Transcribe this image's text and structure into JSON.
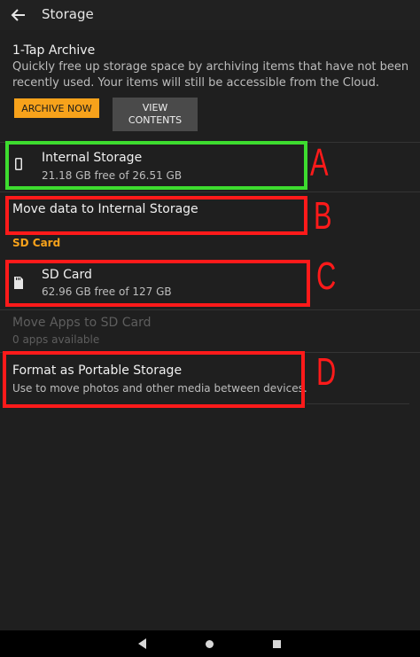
{
  "header": {
    "title": "Storage",
    "back_icon": "back-arrow-icon"
  },
  "archive": {
    "title": "1-Tap Archive",
    "description": "Quickly free up storage space by archiving items that have not been recently used. Your items will still be accessible from the Cloud.",
    "archive_button": "ARCHIVE NOW",
    "view_button": "VIEW\nCONTENTS"
  },
  "internal_storage": {
    "title": "Internal Storage",
    "subtitle": "21.18 GB free of 26.51 GB",
    "icon": "phone-icon"
  },
  "move_data": {
    "title": "Move data to Internal Storage"
  },
  "sd_section": {
    "header": "SD Card"
  },
  "sd_card": {
    "title": "SD Card",
    "subtitle": "62.96 GB free of 127 GB",
    "icon": "sd-card-icon"
  },
  "move_apps": {
    "title": "Move Apps to SD Card",
    "subtitle": "0 apps available"
  },
  "format": {
    "title": "Format as Portable Storage",
    "subtitle": "Use to move photos and other media between devices."
  },
  "annotations": {
    "a": "A",
    "b": "B",
    "c": "C",
    "d": "D",
    "green": "#3ddc2f",
    "red": "#ff1a1a"
  },
  "colors": {
    "accent": "#f7a21b",
    "background": "#1f1f1f"
  },
  "navbar": {
    "back": "nav-back-icon",
    "home": "nav-home-icon",
    "recents": "nav-recents-icon"
  }
}
